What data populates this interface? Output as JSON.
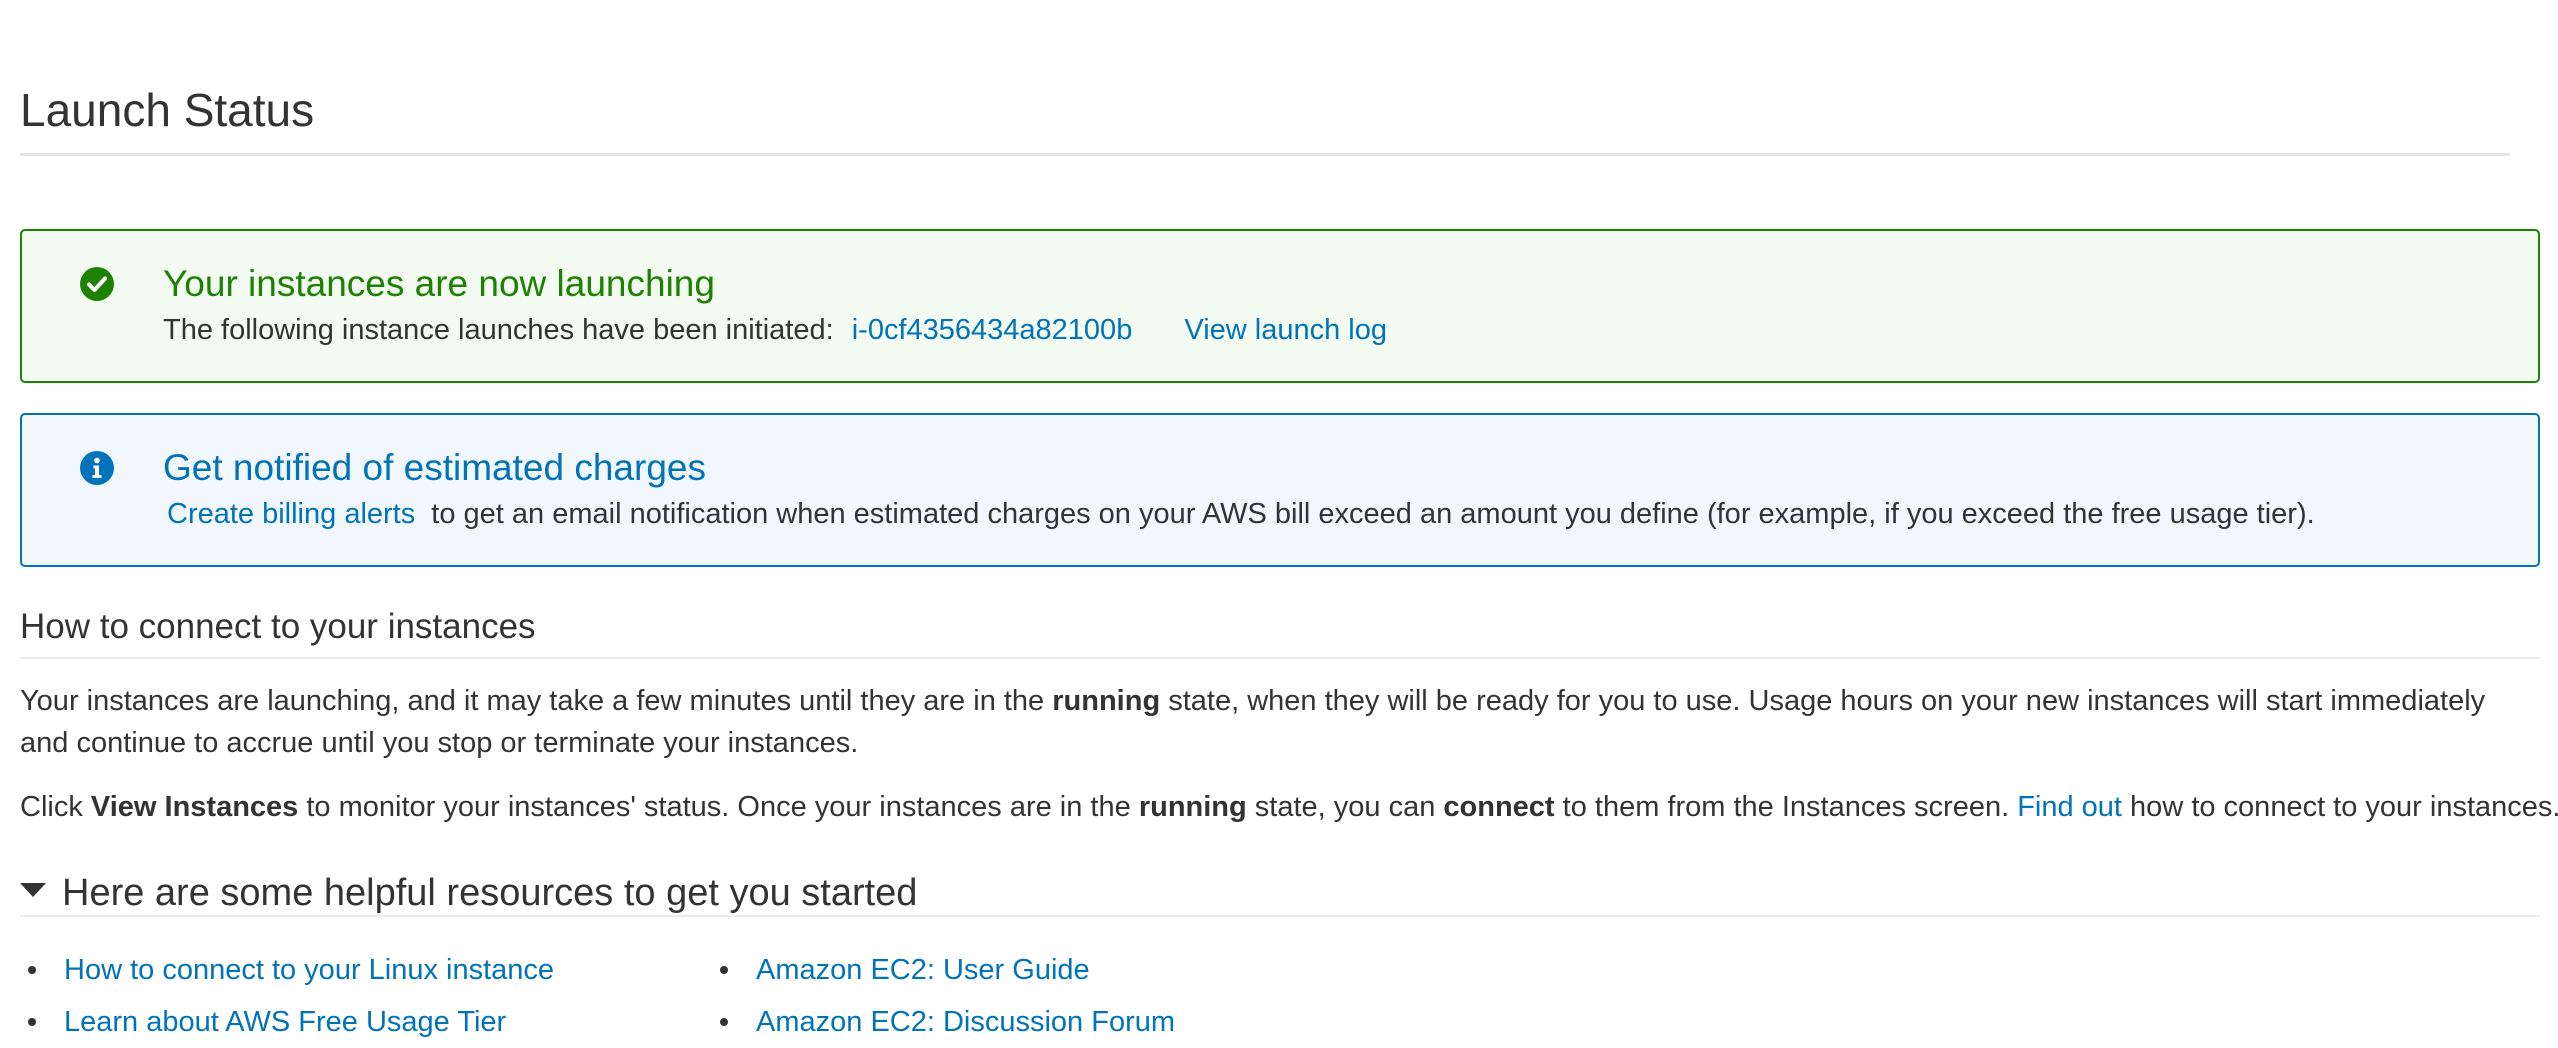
{
  "page_title": "Launch Status",
  "success_alert": {
    "heading": "Your instances are now launching",
    "body_text": "The following instance launches have been initiated:",
    "instance_id": "i-0cf4356434a82100b",
    "view_log_label": "View launch log",
    "icon": "check-circle-icon",
    "color": "#1d8102"
  },
  "info_alert": {
    "heading": "Get notified of estimated charges",
    "link_label": "Create billing alerts",
    "body_text": "to get an email notification when estimated charges on your AWS bill exceed an amount you define (for example, if you exceed the free usage tier).",
    "icon": "info-circle-icon",
    "color": "#0073bb"
  },
  "connect_section": {
    "heading": "How to connect to your instances",
    "para1": {
      "part1": "Your instances are launching, and it may take a few minutes until they are in the ",
      "bold1": "running",
      "part2": " state, when they will be ready for you to use. Usage hours on your new instances will start immediately and continue to accrue until you stop or terminate your instances."
    },
    "para2": {
      "part1": "Click ",
      "bold1": "View Instances",
      "part2": " to monitor your instances' status. Once your instances are in the ",
      "bold2": "running",
      "part3": " state, you can ",
      "bold3": "connect",
      "part4": " to them from the Instances screen. ",
      "link": "Find out",
      "part5": " how to connect to your instances."
    }
  },
  "resources_section": {
    "heading": "Here are some helpful resources to get you started",
    "expanded": true,
    "left_links": [
      "How to connect to your Linux instance",
      "Learn about AWS Free Usage Tier"
    ],
    "right_links": [
      "Amazon EC2: User Guide",
      "Amazon EC2: Discussion Forum"
    ]
  },
  "colors": {
    "link": "#0073bb",
    "text": "#333333",
    "success": "#1d8102",
    "info": "#0073bb"
  }
}
